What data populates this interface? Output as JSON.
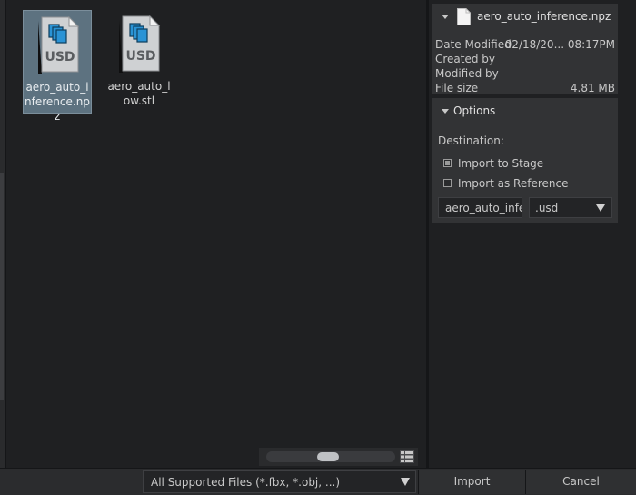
{
  "files": [
    {
      "name": "aero_auto_inference.npz",
      "badge": "USD",
      "selected": true
    },
    {
      "name": "aero_auto_low.stl",
      "badge": "USD",
      "selected": false
    }
  ],
  "info": {
    "file_name": "aero_auto_inference.npz",
    "rows": [
      {
        "key": "Date Modified",
        "value": "02/18/20... 08:17PM"
      },
      {
        "key": "Created by",
        "value": ""
      },
      {
        "key": "Modified by",
        "value": ""
      },
      {
        "key": "File size",
        "value": "4.81 MB"
      }
    ]
  },
  "options": {
    "title": "Options",
    "destination_label": "Destination:",
    "import_to_stage": "Import to Stage",
    "import_as_reference": "Import as Reference",
    "name_value": "aero_auto_infe",
    "extension": ".usd"
  },
  "bottom": {
    "filter": "All Supported Files (*.fbx, *.obj, ...)",
    "import_label": "Import",
    "cancel_label": "Cancel"
  }
}
